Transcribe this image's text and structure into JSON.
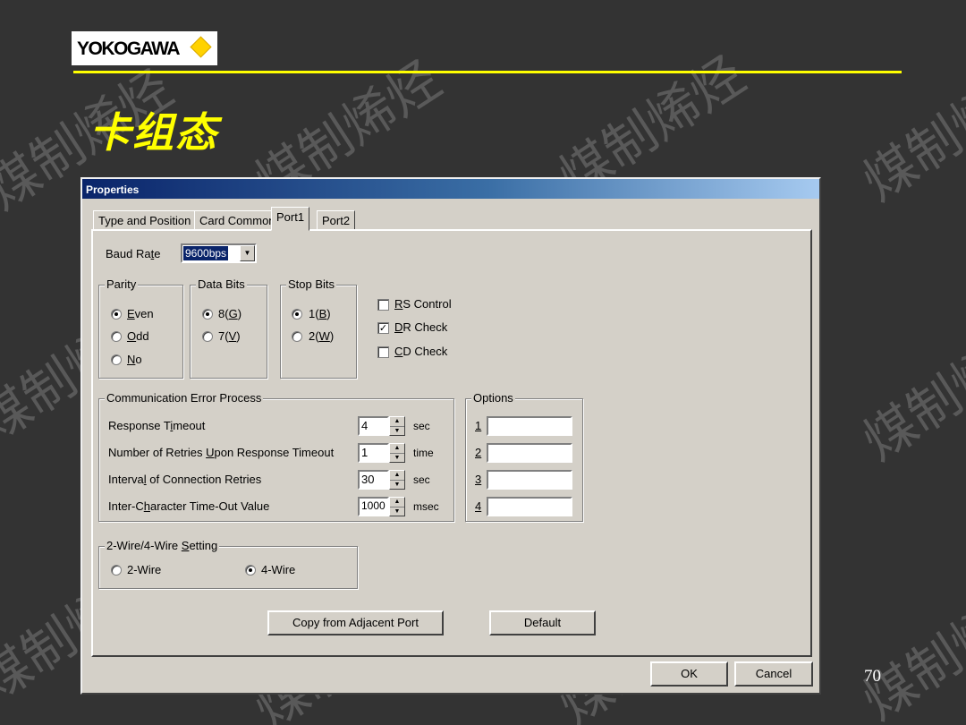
{
  "slide": {
    "logo_text": "YOKOGAWA",
    "title": "卡组态",
    "page_number": "70",
    "watermark": "煤制烯烃",
    "colors": {
      "background": "#333333",
      "title": "#ffff00",
      "rule": "#ffff00"
    }
  },
  "dialog": {
    "title": "Properties",
    "tabs": [
      {
        "label": "Type and Position",
        "active": false
      },
      {
        "label": "Card Common",
        "active": false
      },
      {
        "label": "Port1",
        "active": true
      },
      {
        "label": "Port2",
        "active": false
      }
    ],
    "baud_rate": {
      "label_pre": "Baud Ra",
      "label_key": "t",
      "label_post": "e",
      "value": "9600bps"
    },
    "parity": {
      "legend": "Parity",
      "options": [
        {
          "key": "E",
          "rest": "ven",
          "selected": true
        },
        {
          "key": "O",
          "rest": "dd",
          "selected": false
        },
        {
          "key": "N",
          "rest": "o",
          "selected": false
        }
      ]
    },
    "data_bits": {
      "legend": "Data Bits",
      "options": [
        {
          "pre": "8(",
          "key": "G",
          "post": ")",
          "selected": true
        },
        {
          "pre": "7(",
          "key": "V",
          "post": ")",
          "selected": false
        }
      ]
    },
    "stop_bits": {
      "legend": "Stop Bits",
      "options": [
        {
          "pre": "1(",
          "key": "B",
          "post": ")",
          "selected": true
        },
        {
          "pre": "2(",
          "key": "W",
          "post": ")",
          "selected": false
        }
      ]
    },
    "controls": [
      {
        "key": "R",
        "rest": "S Control",
        "checked": false
      },
      {
        "key": "D",
        "rest": "R Check",
        "checked": true
      },
      {
        "key": "C",
        "rest": "D Check",
        "checked": false
      }
    ],
    "comm_error": {
      "legend": "Communication Error Process",
      "rows": [
        {
          "pre": "Response T",
          "key": "i",
          "post": "meout",
          "value": "4",
          "unit": "sec"
        },
        {
          "pre": "Number of Retries ",
          "key": "U",
          "post": "pon Response Timeout",
          "value": "1",
          "unit": "time"
        },
        {
          "pre": "Interva",
          "key": "l",
          "post": " of Connection Retries",
          "value": "30",
          "unit": "sec"
        },
        {
          "pre": "Inter-C",
          "key": "h",
          "post": "aracter Time-Out Value",
          "value": "1000",
          "unit": "msec"
        }
      ]
    },
    "options": {
      "legend": "Options",
      "items": [
        {
          "label": "1",
          "value": ""
        },
        {
          "label": "2",
          "value": ""
        },
        {
          "label": "3",
          "value": ""
        },
        {
          "label": "4",
          "value": ""
        }
      ]
    },
    "wire": {
      "legend_pre": "2-Wire/4-Wire ",
      "legend_key": "S",
      "legend_post": "etting",
      "options": [
        {
          "label": "2-Wire",
          "selected": false
        },
        {
          "label": "4-Wire",
          "selected": true
        }
      ]
    },
    "buttons": {
      "copy": {
        "pre": "Copy from Ad",
        "key": "j",
        "post": "acent Port"
      },
      "default": "Default",
      "ok": "OK",
      "cancel": "Cancel"
    }
  }
}
